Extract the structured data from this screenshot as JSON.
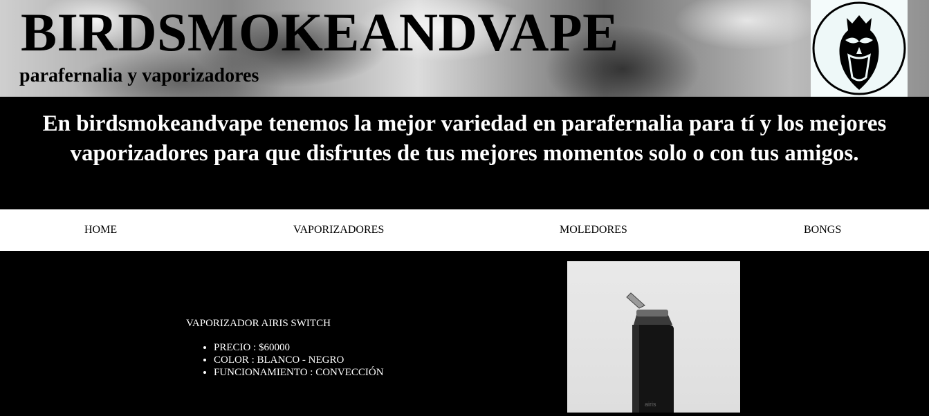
{
  "header": {
    "brand": "BIRDSMOKEANDVAPE",
    "tagline": "parafernalia y vaporizadores",
    "logo_icon": "owl-logo-icon"
  },
  "intro": {
    "text": "En birdsmokeandvape tenemos la mejor variedad en parafernalia para tí y los mejores vaporizadores para que disfrutes de tus mejores momentos solo o con tus amigos."
  },
  "nav": {
    "items": [
      {
        "label": "HOME"
      },
      {
        "label": "VAPORIZADORES"
      },
      {
        "label": "MOLEDORES"
      },
      {
        "label": "BONGS"
      }
    ]
  },
  "product": {
    "title": "VAPORIZADOR AIRIS SWITCH",
    "specs": [
      "PRECIO : $60000",
      "COLOR : BLANCO - NEGRO",
      "FUNCIONAMIENTO : CONVECCIÓN"
    ],
    "image_label": "airis"
  },
  "colors": {
    "background": "#000000",
    "nav_background": "#ffffff",
    "text_light": "#ffffff",
    "text_dark": "#000000"
  }
}
